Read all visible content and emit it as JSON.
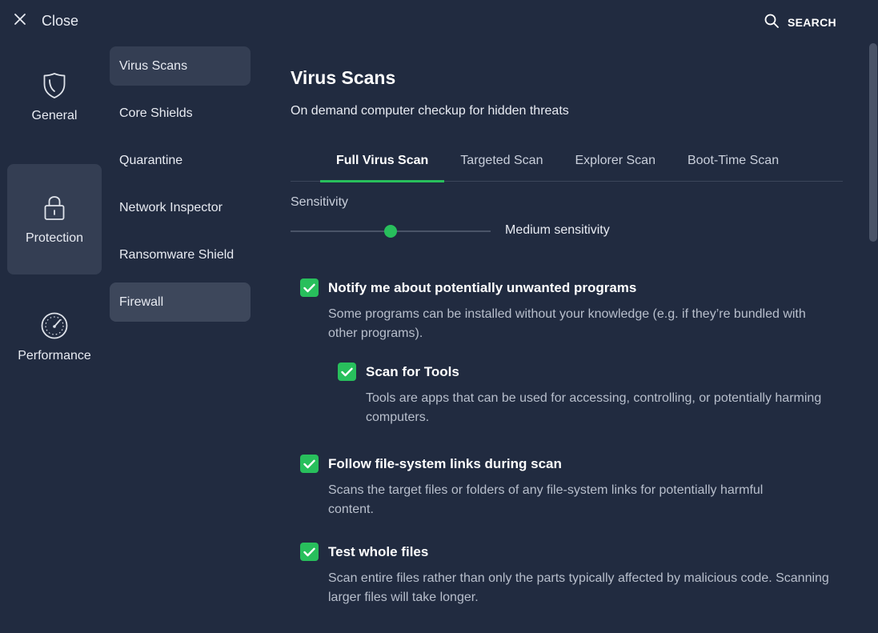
{
  "topbar": {
    "close_label": "Close",
    "search_label": "SEARCH"
  },
  "rail": {
    "items": [
      {
        "label": "General",
        "icon": "shield-icon",
        "active": false
      },
      {
        "label": "Protection",
        "icon": "lock-icon",
        "active": true
      },
      {
        "label": "Performance",
        "icon": "speedometer-icon",
        "active": false
      }
    ]
  },
  "submenu": {
    "items": [
      {
        "label": "Virus Scans",
        "state": "selected"
      },
      {
        "label": "Core Shields",
        "state": "normal"
      },
      {
        "label": "Quarantine",
        "state": "normal"
      },
      {
        "label": "Network Inspector",
        "state": "normal"
      },
      {
        "label": "Ransomware Shield",
        "state": "normal"
      },
      {
        "label": "Firewall",
        "state": "hover"
      }
    ]
  },
  "main": {
    "title": "Virus Scans",
    "subtitle": "On demand computer checkup for hidden threats",
    "tabs": [
      {
        "label": "Full Virus Scan",
        "active": true
      },
      {
        "label": "Targeted Scan",
        "active": false
      },
      {
        "label": "Explorer Scan",
        "active": false
      },
      {
        "label": "Boot-Time Scan",
        "active": false
      }
    ],
    "sensitivity": {
      "label": "Sensitivity",
      "value_label": "Medium sensitivity",
      "level_fraction": 0.5
    },
    "options": [
      {
        "title": "Notify me about potentially unwanted programs",
        "description": "Some programs can be installed without your knowledge (e.g. if they’re bundled with other programs).",
        "checked": true
      },
      {
        "title": "Scan for Tools",
        "description": "Tools are apps that can be used for accessing, controlling, or potentially harming computers.",
        "checked": true
      },
      {
        "title": "Follow file-system links during scan",
        "description": "Scans the target files or folders of any file-system links for potentially harmful content.",
        "checked": true
      },
      {
        "title": "Test whole files",
        "description": "Scan entire files rather than only the parts typically affected by malicious code. Scanning larger files will take longer.",
        "checked": true
      }
    ]
  },
  "colors": {
    "background": "#212b40",
    "panel_selected": "#343e53",
    "accent_green": "#28bf5c",
    "text_primary": "#ffffff",
    "text_secondary": "#b8bfcc"
  }
}
